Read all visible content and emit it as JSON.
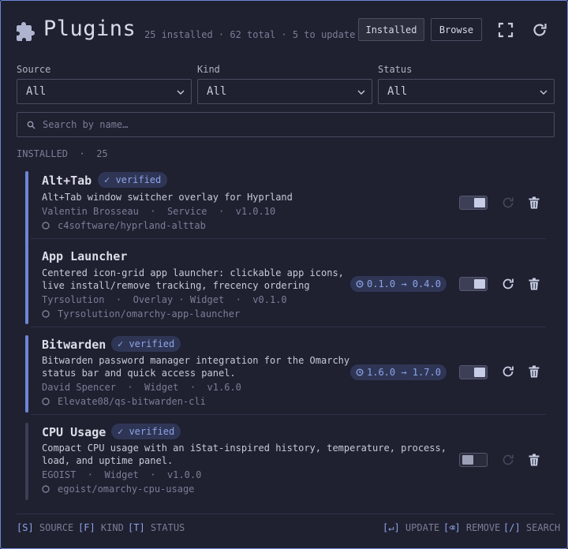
{
  "header": {
    "title": "Plugins",
    "stats": "25 installed · 62 total · 5 to update",
    "installed_label": "Installed",
    "browse_label": "Browse"
  },
  "filters": {
    "source": {
      "label": "Source",
      "value": "All"
    },
    "kind": {
      "label": "Kind",
      "value": "All"
    },
    "status": {
      "label": "Status",
      "value": "All"
    }
  },
  "search": {
    "placeholder": "Search by name…"
  },
  "section": {
    "label": "INSTALLED",
    "count": "25"
  },
  "plugins": [
    {
      "name": "Alt+Tab",
      "verified": "✓ verified",
      "desc1": "Alt+Tab window switcher overlay for Hyprland",
      "desc2": "",
      "meta": "Valentin Brosseau  ·  Service  ·  v1.0.10",
      "repo": "c4software/hyprland-alttab",
      "update": "",
      "enabled": true
    },
    {
      "name": "App Launcher",
      "verified": "",
      "desc1": "Centered icon-grid app launcher: clickable app icons,",
      "desc2": "live install/remove tracking, frecency ordering",
      "meta": "Tyrsolution  ·  Overlay · Widget  ·  v0.1.0",
      "repo": "Tyrsolution/omarchy-app-launcher",
      "update": "0.1.0 → 0.4.0",
      "enabled": true
    },
    {
      "name": "Bitwarden",
      "verified": "✓ verified",
      "desc1": "Bitwarden password manager integration for the Omarchy",
      "desc2": "status bar and quick access panel.",
      "meta": "David Spencer  ·  Widget  ·  v1.6.0",
      "repo": "Elevate08/qs-bitwarden-cli",
      "update": "1.6.0 → 1.7.0",
      "enabled": true
    },
    {
      "name": "CPU Usage",
      "verified": "✓ verified",
      "desc1": "Compact CPU usage with an iStat-inspired history, temperature, process,",
      "desc2": "load, and uptime panel.",
      "meta": "EGOIST  ·  Widget  ·  v1.0.0",
      "repo": "egoist/omarchy-cpu-usage",
      "update": "",
      "enabled": false
    }
  ],
  "footer": {
    "source": {
      "key": "[S]",
      "label": "SOURCE"
    },
    "kind": {
      "key": "[F]",
      "label": "KIND"
    },
    "status": {
      "key": "[T]",
      "label": "STATUS"
    },
    "update": {
      "key": "[↵]",
      "label": "UPDATE"
    },
    "remove": {
      "key": "[⌫]",
      "label": "REMOVE"
    },
    "search": {
      "key": "[/]",
      "label": "SEARCH"
    }
  },
  "colors": {
    "accent": "#6f86d6",
    "badge_bg": "#2f3655",
    "background": "#1f2030"
  }
}
